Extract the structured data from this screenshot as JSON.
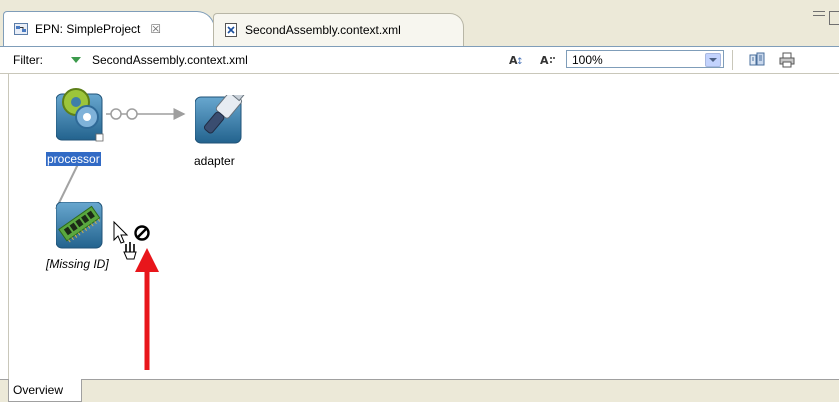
{
  "tabs": [
    {
      "label": "EPN: SimpleProject",
      "close": "☒",
      "icon": "epn-diagram-icon"
    },
    {
      "label": "SecondAssembly.context.xml",
      "icon": "xml-file-icon"
    }
  ],
  "window": {
    "minimize_icon": "minimize-icon",
    "maximize_icon": "maximize-icon"
  },
  "filter": {
    "label": "Filter:",
    "value": "SecondAssembly.context.xml",
    "zoom": "100%"
  },
  "toolbar_icons": [
    "layout-icon",
    "grid-layout-icon",
    "export-icon",
    "print-icon"
  ],
  "nodes": [
    {
      "name": "processor",
      "icon": "processor-gear-icon",
      "selected": true
    },
    {
      "name": "adapter",
      "icon": "adapter-plug-icon",
      "selected": false
    },
    {
      "name": "[Missing ID]",
      "icon": "memory-chip-icon",
      "selected": false
    }
  ],
  "bottom_tabs": [
    {
      "label": "Overview"
    }
  ],
  "colors": {
    "selection": "#316ac5",
    "arrow_annotation": "#e8161b",
    "node_bg": "#3f7fa8",
    "tab_border": "#7f9db9"
  }
}
